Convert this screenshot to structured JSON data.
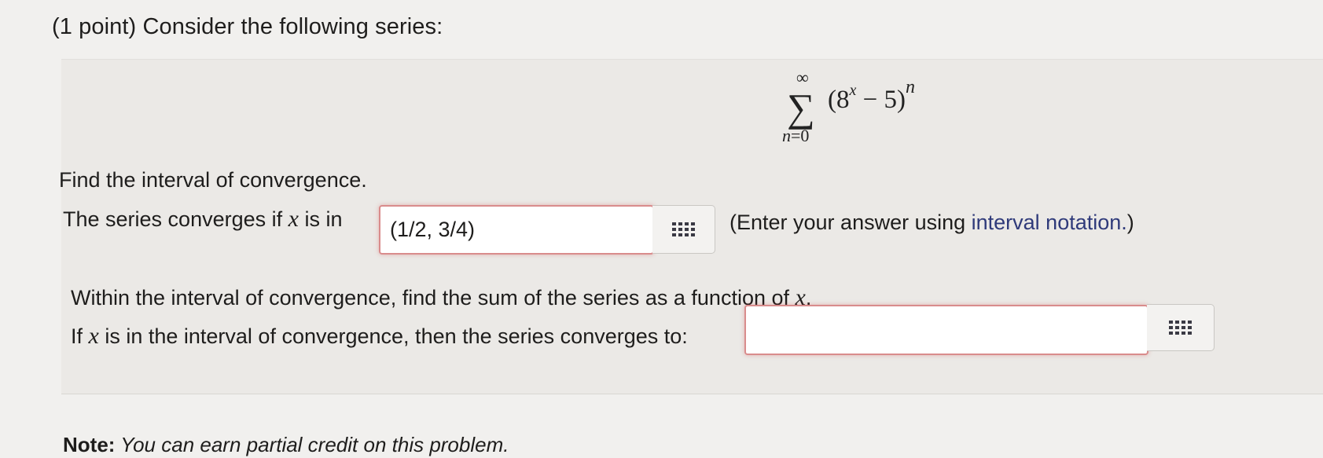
{
  "problem": {
    "header": "(1 point) Consider the following series:",
    "series": {
      "sigma": "∑",
      "upper_limit": "∞",
      "index_var": "n",
      "index_eq": "=",
      "index_start": "0",
      "term_open": "(8",
      "term_exp": "x",
      "term_rest": " − 5)",
      "term_power": "n"
    }
  },
  "part1": {
    "instruction": "Find the interval of convergence.",
    "prompt_before": "The series converges if ",
    "prompt_var": "x",
    "prompt_after": " is in",
    "answer_value": "(1/2, 3/4)",
    "hint_before": "(Enter your answer using ",
    "hint_link": "interval notation.",
    "hint_after": ")"
  },
  "part2": {
    "instruction_before": "Within the interval of convergence, find the sum of the series as a function of ",
    "instruction_var": "x",
    "instruction_after": ".",
    "prompt_before": "If ",
    "prompt_var": "x",
    "prompt_after": " is in the interval of convergence, then the series converges to:",
    "answer_value": ""
  },
  "note": {
    "label": "Note:",
    "text": " You can earn partial credit on this problem."
  },
  "icons": {
    "answer_tool": "grid-icon"
  },
  "colors": {
    "background": "#f1f0ee",
    "panel": "#ebe9e6",
    "error_border": "#d98c8c",
    "link": "#2f3a7a"
  }
}
